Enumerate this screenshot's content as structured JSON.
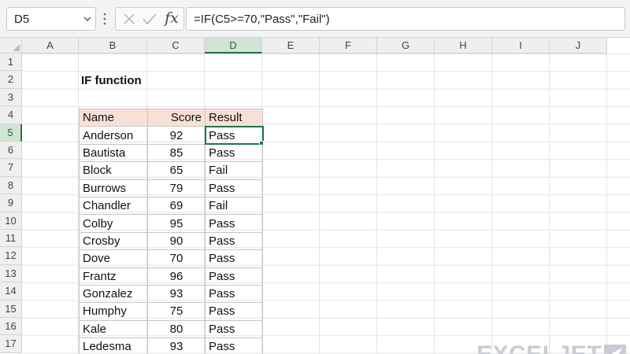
{
  "formula_bar": {
    "name_box": "D5",
    "fx_label": "fx",
    "formula": "=IF(C5>=70,\"Pass\",\"Fail\")"
  },
  "columns": [
    "A",
    "B",
    "C",
    "D",
    "E",
    "F",
    "G",
    "H",
    "I",
    "J"
  ],
  "active_column": "D",
  "rows": [
    "1",
    "2",
    "3",
    "4",
    "5",
    "6",
    "7",
    "8",
    "9",
    "10",
    "11",
    "12",
    "13",
    "14",
    "15",
    "16",
    "17"
  ],
  "active_row": "5",
  "sheet": {
    "title": "IF function",
    "headers": {
      "name": "Name",
      "score": "Score",
      "result": "Result"
    },
    "records": [
      {
        "name": "Anderson",
        "score": "92",
        "result": "Pass"
      },
      {
        "name": "Bautista",
        "score": "85",
        "result": "Pass"
      },
      {
        "name": "Block",
        "score": "65",
        "result": "Fail"
      },
      {
        "name": "Burrows",
        "score": "79",
        "result": "Pass"
      },
      {
        "name": "Chandler",
        "score": "69",
        "result": "Fail"
      },
      {
        "name": "Colby",
        "score": "95",
        "result": "Pass"
      },
      {
        "name": "Crosby",
        "score": "90",
        "result": "Pass"
      },
      {
        "name": "Dove",
        "score": "70",
        "result": "Pass"
      },
      {
        "name": "Frantz",
        "score": "96",
        "result": "Pass"
      },
      {
        "name": "Gonzalez",
        "score": "93",
        "result": "Pass"
      },
      {
        "name": "Humphy",
        "score": "75",
        "result": "Pass"
      },
      {
        "name": "Kale",
        "score": "80",
        "result": "Pass"
      },
      {
        "name": "Ledesma",
        "score": "93",
        "result": "Pass"
      }
    ]
  },
  "logo": {
    "text": "EXCELJET",
    "icon": "exceljet-logo-icon"
  },
  "colors": {
    "accent": "#217346",
    "header_fill": "#f9e0d6"
  }
}
